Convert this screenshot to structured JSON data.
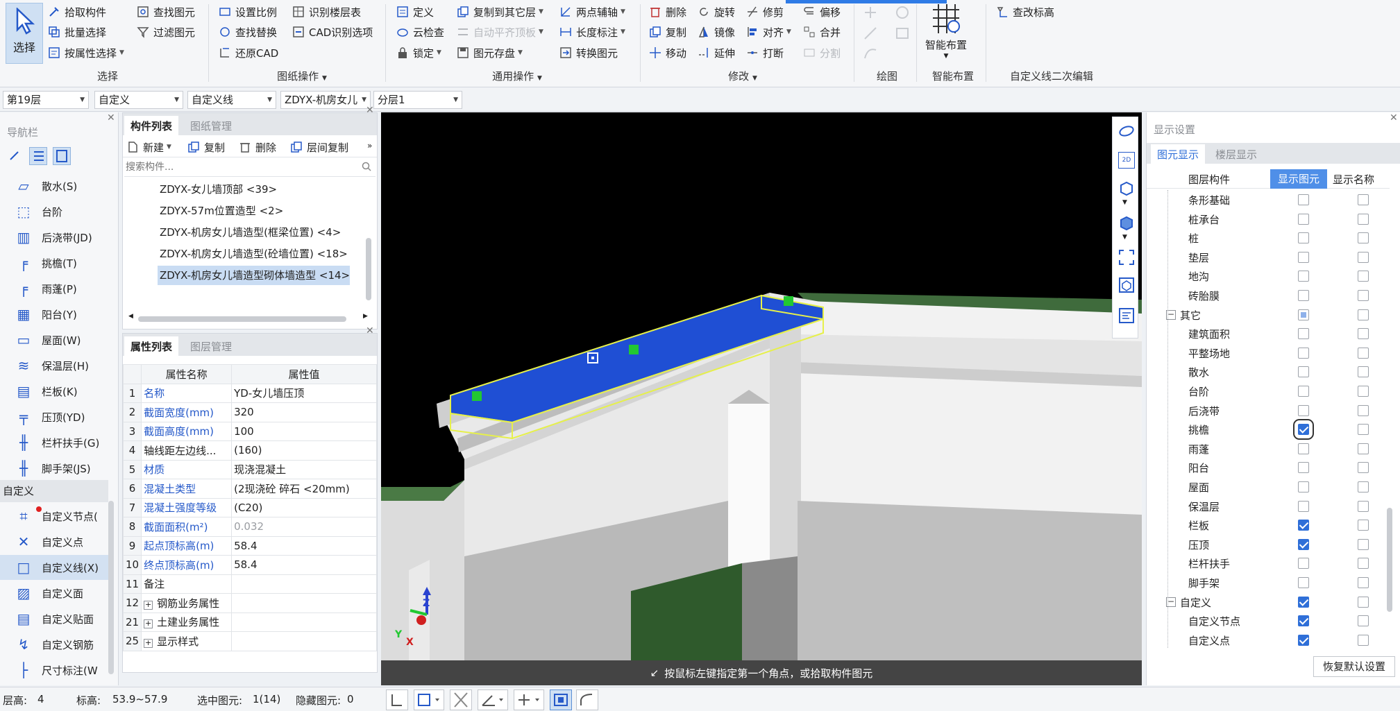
{
  "ribbon": {
    "select": {
      "label": "选择"
    },
    "groups": {
      "select": "选择",
      "drawing_ops": "图纸操作",
      "general_ops": "通用操作",
      "modify": "修改",
      "draw": "绘图",
      "smart_layout": "智能布置",
      "custom_line_edit": "自定义线二次编辑"
    },
    "buttons": {
      "pick_component": "拾取构件",
      "batch_select": "批量选择",
      "select_by_attr": "按属性选择",
      "find_element": "查找图元",
      "filter_element": "过滤图元",
      "set_scale": "设置比例",
      "find_replace": "查找替换",
      "restore_cad": "还原CAD",
      "identify_floor_table": "识别楼层表",
      "cad_options": "CAD识别选项",
      "define": "定义",
      "cloud_check": "云检查",
      "lock": "锁定",
      "copy_to_other_layer": "复制到其它层",
      "auto_flush_top": "自动平齐顶板",
      "element_save": "图元存盘",
      "two_point_axis": "两点辅轴",
      "length_dim": "长度标注",
      "convert_element": "转换图元",
      "delete": "删除",
      "copy": "复制",
      "move": "移动",
      "rotate": "旋转",
      "mirror": "镜像",
      "extend": "延伸",
      "trim": "修剪",
      "align": "对齐",
      "break": "打断",
      "offset": "偏移",
      "merge": "合并",
      "split": "分割",
      "smart_layout": "智能布置",
      "check_elevation": "查改标高"
    }
  },
  "layerbar": {
    "floor": "第19层",
    "type": "自定义",
    "subtype": "自定义线",
    "component": "ZDYX-机房女儿",
    "layer": "分层1"
  },
  "nav": {
    "title": "导航栏",
    "items": [
      "散水(S)",
      "台阶",
      "后浇带(JD)",
      "挑檐(T)",
      "雨蓬(P)",
      "阳台(Y)",
      "屋面(W)",
      "保温层(H)",
      "栏板(K)",
      "压顶(YD)",
      "栏杆扶手(G)",
      "脚手架(JS)"
    ],
    "section": "自定义",
    "custom_items": [
      "自定义节点(",
      "自定义点",
      "自定义线(X)",
      "自定义面",
      "自定义贴面",
      "自定义钢筋",
      "尺寸标注(W"
    ]
  },
  "component_panel": {
    "tabs": [
      "构件列表",
      "图纸管理"
    ],
    "toolbar": {
      "new": "新建",
      "copy": "复制",
      "delete": "删除",
      "cross_layer_copy": "层间复制"
    },
    "search_placeholder": "搜索构件...",
    "items": [
      "ZDYX-女儿墙顶部 <39>",
      "ZDYX-57m位置造型 <2>",
      "ZDYX-机房女儿墙造型(框梁位置)  <4>",
      "ZDYX-机房女儿墙造型(砼墙位置)  <18>",
      "ZDYX-机房女儿墙造型砌体墙造型  <14>"
    ]
  },
  "props_panel": {
    "tabs": [
      "属性列表",
      "图层管理"
    ],
    "headers": [
      "属性名称",
      "属性值"
    ],
    "rows": [
      {
        "n": "1",
        "name": "名称",
        "value": "YD-女儿墙压顶"
      },
      {
        "n": "2",
        "name": "截面宽度(mm)",
        "value": "320"
      },
      {
        "n": "3",
        "name": "截面高度(mm)",
        "value": "100"
      },
      {
        "n": "4",
        "name": "轴线距左边线...",
        "value": "(160)"
      },
      {
        "n": "5",
        "name": "材质",
        "value": "现浇混凝土"
      },
      {
        "n": "6",
        "name": "混凝土类型",
        "value": "(2现浇砼 碎石 <20mm)"
      },
      {
        "n": "7",
        "name": "混凝土强度等级",
        "value": "(C20)"
      },
      {
        "n": "8",
        "name": "截面面积(m²)",
        "value": "0.032"
      },
      {
        "n": "9",
        "name": "起点顶标高(m)",
        "value": "58.4"
      },
      {
        "n": "10",
        "name": "终点顶标高(m)",
        "value": "58.4"
      },
      {
        "n": "11",
        "name": "备注",
        "value": ""
      },
      {
        "n": "12",
        "name": "钢筋业务属性",
        "value": ""
      },
      {
        "n": "21",
        "name": "土建业务属性",
        "value": ""
      },
      {
        "n": "25",
        "name": "显示样式",
        "value": ""
      }
    ]
  },
  "viewport": {
    "status_message": "按鼠标左键指定第一个角点，或拾取构件图元",
    "axis_z": "Z",
    "axis_y": "Y",
    "axis_x": "X"
  },
  "display_panel": {
    "title": "显示设置",
    "tabs": [
      "图元显示",
      "楼层显示"
    ],
    "headers": [
      "图层构件",
      "显示图元",
      "显示名称"
    ],
    "rows": [
      {
        "label": "条形基础",
        "show": false,
        "name": false,
        "level": 2
      },
      {
        "label": "桩承台",
        "show": false,
        "name": false,
        "level": 2
      },
      {
        "label": "桩",
        "show": false,
        "name": false,
        "level": 2
      },
      {
        "label": "垫层",
        "show": false,
        "name": false,
        "level": 2
      },
      {
        "label": "地沟",
        "show": false,
        "name": false,
        "level": 2
      },
      {
        "label": "砖胎膜",
        "show": false,
        "name": false,
        "level": 2
      },
      {
        "label": "其它",
        "show": "partial",
        "name": false,
        "level": 1
      },
      {
        "label": "建筑面积",
        "show": false,
        "name": false,
        "level": 2
      },
      {
        "label": "平整场地",
        "show": false,
        "name": false,
        "level": 2
      },
      {
        "label": "散水",
        "show": false,
        "name": false,
        "level": 2
      },
      {
        "label": "台阶",
        "show": false,
        "name": false,
        "level": 2
      },
      {
        "label": "后浇带",
        "show": false,
        "name": false,
        "level": 2
      },
      {
        "label": "挑檐",
        "show": true,
        "name": false,
        "level": 2
      },
      {
        "label": "雨蓬",
        "show": false,
        "name": false,
        "level": 2
      },
      {
        "label": "阳台",
        "show": false,
        "name": false,
        "level": 2
      },
      {
        "label": "屋面",
        "show": false,
        "name": false,
        "level": 2
      },
      {
        "label": "保温层",
        "show": false,
        "name": false,
        "level": 2
      },
      {
        "label": "栏板",
        "show": true,
        "name": false,
        "level": 2
      },
      {
        "label": "压顶",
        "show": true,
        "name": false,
        "level": 2
      },
      {
        "label": "栏杆扶手",
        "show": false,
        "name": false,
        "level": 2
      },
      {
        "label": "脚手架",
        "show": false,
        "name": false,
        "level": 2
      },
      {
        "label": "自定义",
        "show": true,
        "name": false,
        "level": 1
      },
      {
        "label": "自定义节点",
        "show": true,
        "name": false,
        "level": 2
      },
      {
        "label": "自定义点",
        "show": true,
        "name": false,
        "level": 2
      }
    ],
    "restore_default": "恢复默认设置"
  },
  "statusbar": {
    "floor_height_label": "层高:",
    "floor_height": "4",
    "elevation_label": "标高:",
    "elevation": "53.9~57.9",
    "selected_label": "选中图元:",
    "selected": "1(14)",
    "hidden_label": "隐藏图元:",
    "hidden": "0"
  },
  "colors": {
    "accent": "#2f6fd8",
    "selection": "#1f4fd4",
    "highlight": "#e6f04a",
    "grip": "#22c832"
  }
}
